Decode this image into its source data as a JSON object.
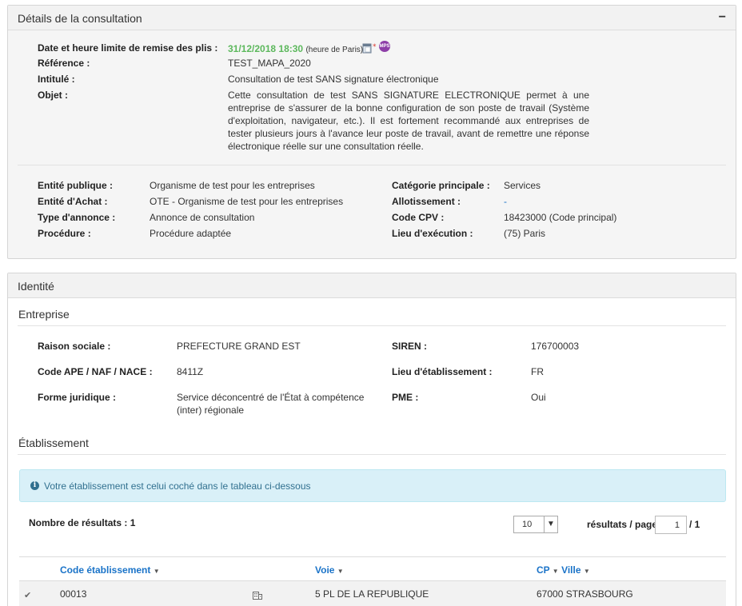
{
  "consultation": {
    "title": "Détails de la consultation",
    "toggle": "−",
    "date_label": "Date et heure limite de remise des plis :",
    "date_value": "31/12/2018 18:30",
    "date_note": "(heure de Paris)",
    "reference_label": "Référence :",
    "reference_value": "TEST_MAPA_2020",
    "intitule_label": "Intitulé :",
    "intitule_value": "Consultation de test SANS signature électronique",
    "objet_label": "Objet :",
    "objet_value": "Cette consultation de test SANS SIGNATURE ELECTRONIQUE permet à une entreprise de s'assurer de la bonne configuration de son poste de travail (Système d'exploitation, navigateur, etc.). Il est fortement recommandé aux entreprises de tester plusieurs jours à l'avance leur poste de travail, avant de remettre une réponse électronique réelle sur une consultation réelle.",
    "left_fields": [
      {
        "label": "Entité publique :",
        "value": "Organisme de test pour les entreprises"
      },
      {
        "label": "Entité d'Achat :",
        "value": "OTE - Organisme de test pour les entreprises"
      },
      {
        "label": "Type d'annonce :",
        "value": "Annonce de consultation"
      },
      {
        "label": "Procédure :",
        "value": "Procédure adaptée"
      }
    ],
    "right_fields": [
      {
        "label": "Catégorie principale :",
        "value": "Services"
      },
      {
        "label": "Allotissement :",
        "value": "-"
      },
      {
        "label": "Code CPV :",
        "value": "18423000 (Code principal)"
      },
      {
        "label": "Lieu d'exécution :",
        "value": "(75) Paris"
      }
    ],
    "mps_badge": "MPS"
  },
  "identite": {
    "title": "Identité",
    "entreprise_title": "Entreprise",
    "raison_label": "Raison sociale :",
    "raison_value": "PREFECTURE GRAND EST",
    "siren_label": "SIREN :",
    "siren_value": "176700003",
    "ape_label": "Code APE / NAF / NACE :",
    "ape_value": "8411Z",
    "lieu_label": "Lieu d'établissement :",
    "lieu_value": "FR",
    "forme_label": "Forme juridique :",
    "forme_value_1": "Service déconcentré de l'État à compétence",
    "forme_value_2": "(inter) régionale",
    "pme_label": "PME :",
    "pme_value": "Oui",
    "etablissement_title": "Établissement",
    "alert_text": "Votre établissement est celui coché dans le tableau ci-dessous",
    "nb_resultats": "Nombre de résultats : 1",
    "per_page_value": "10",
    "per_page_label": "résultats / page",
    "page_value": "1",
    "page_total": "/ 1",
    "columns": {
      "code": "Code établissement",
      "voie": "Voie",
      "cp": "CP",
      "ville": "Ville"
    },
    "row": {
      "check": "✔",
      "code": "00013",
      "voie": "5 PL DE LA REPUBLIQUE",
      "cp_ville": "67000 STRASBOURG"
    }
  }
}
